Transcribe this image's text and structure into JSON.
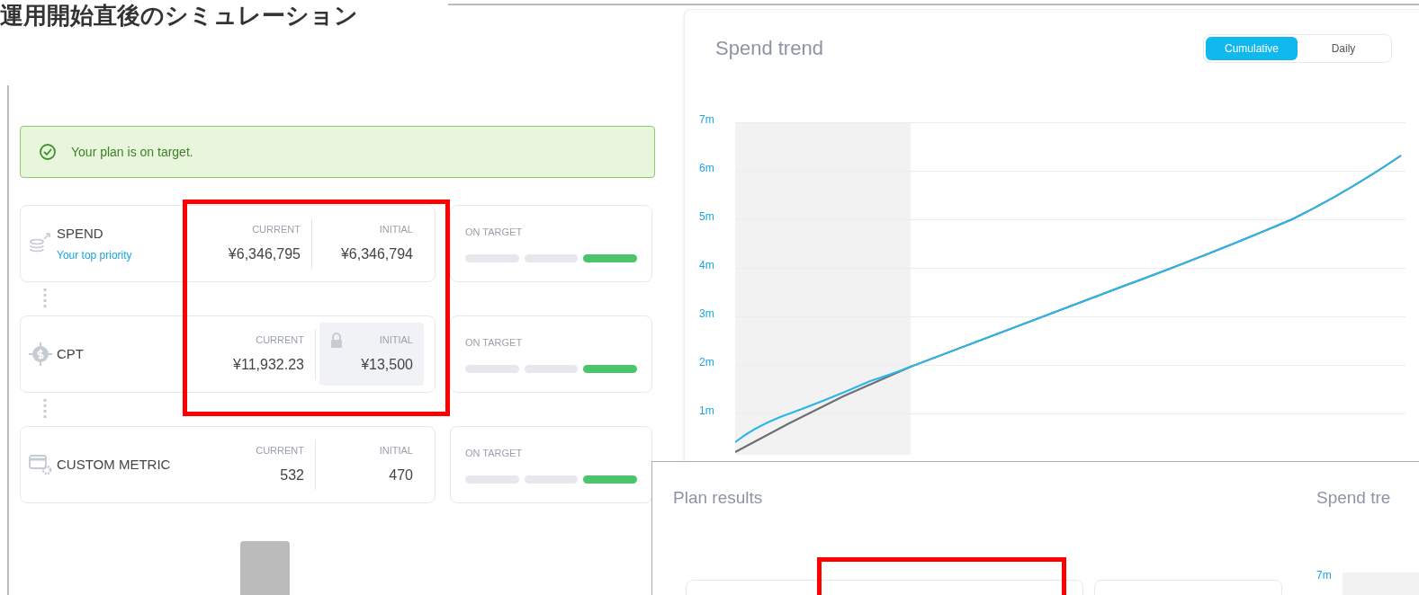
{
  "title": "運用開始直後のシミュレーション",
  "plan": {
    "banner": "Your plan is on target.",
    "metrics": [
      {
        "kind": "spend",
        "name": "SPEND",
        "subtitle": "Your top priority",
        "current_label": "CURRENT",
        "current": "¥6,346,795",
        "initial_label": "INITIAL",
        "initial": "¥6,346,794",
        "locked": false,
        "status": "ON TARGET",
        "segments": [
          {
            "on": false
          },
          {
            "on": false
          },
          {
            "on": true
          }
        ]
      },
      {
        "kind": "cpt",
        "name": "CPT",
        "current_label": "CURRENT",
        "current": "¥11,932.23",
        "initial_label": "INITIAL",
        "initial": "¥13,500",
        "locked": true,
        "status": "ON TARGET",
        "segments": [
          {
            "on": false
          },
          {
            "on": false
          },
          {
            "on": true
          }
        ]
      },
      {
        "kind": "custom",
        "name": "CUSTOM METRIC",
        "current_label": "CURRENT",
        "current": "532",
        "initial_label": "INITIAL",
        "initial": "470",
        "locked": false,
        "status": "ON TARGET",
        "segments": [
          {
            "on": false
          },
          {
            "on": false
          },
          {
            "on": true
          }
        ]
      }
    ]
  },
  "trend": {
    "title": "Spend trend",
    "toggle": [
      {
        "label": "Cumulative",
        "selected": true
      },
      {
        "label": "Daily",
        "selected": false
      }
    ],
    "y_ticks": [
      "7m",
      "6m",
      "5m",
      "4m",
      "3m",
      "2m",
      "1m"
    ]
  },
  "overlay": {
    "title": "Plan results",
    "next_title": "Spend tre",
    "y_tick": "7m"
  }
}
